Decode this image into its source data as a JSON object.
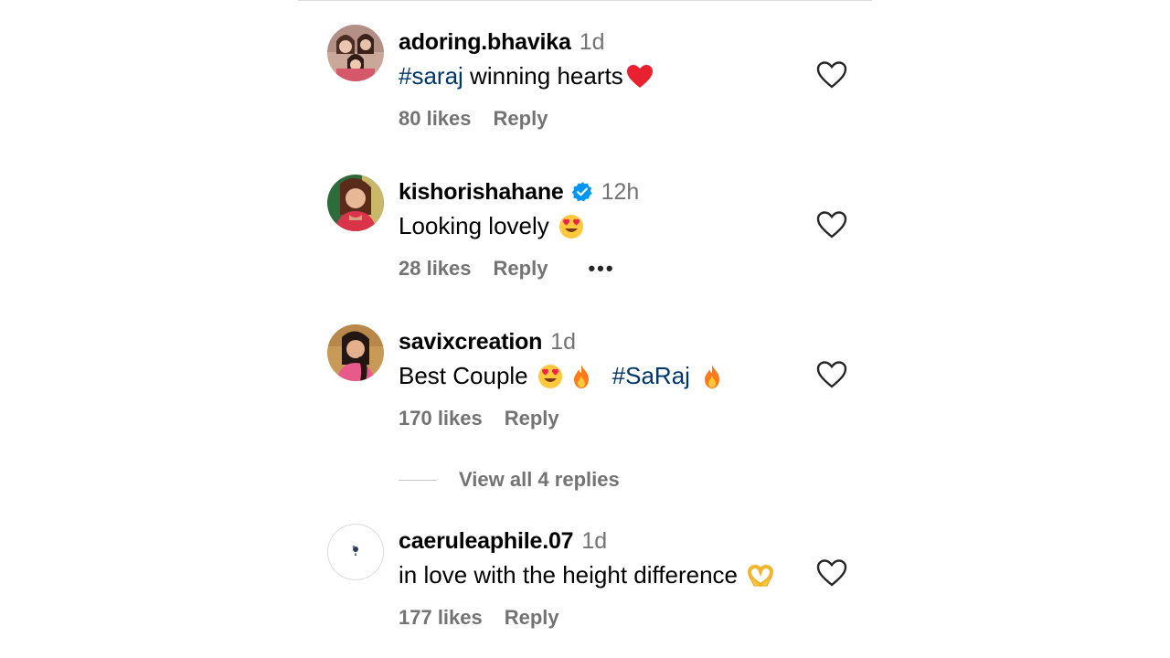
{
  "comments": [
    {
      "username": "adoring.bhavika",
      "time": "1d",
      "text_parts": [
        "#saraj",
        " winning hearts"
      ],
      "likes": "80 likes",
      "reply": "Reply"
    },
    {
      "username": "kishorishahane",
      "time": "12h",
      "verified": true,
      "text_parts": [
        "Looking lovely"
      ],
      "likes": "28 likes",
      "reply": "Reply",
      "more": "•••"
    },
    {
      "username": "savixcreation",
      "time": "1d",
      "text_parts": [
        "Best Couple",
        "#SaRaj"
      ],
      "likes": "170 likes",
      "reply": "Reply"
    },
    {
      "username": "caeruleaphile.07",
      "time": "1d",
      "text_parts": [
        "in love with the height difference"
      ],
      "likes": "177 likes",
      "reply": "Reply"
    }
  ],
  "view_replies": "View all 4 replies",
  "icons": {
    "like": "heart-outline-icon",
    "verified": "verified-badge-icon",
    "red_heart": "red-heart-emoji",
    "heart_eyes": "heart-eyes-emoji",
    "fire": "fire-emoji",
    "heart_hands": "heart-hands-emoji"
  },
  "colors": {
    "hashtag": "#00376b",
    "secondary": "#737373",
    "verified": "#0095f6",
    "red_heart": "#e8202f",
    "emoji_yellow": "#ffc83d"
  }
}
